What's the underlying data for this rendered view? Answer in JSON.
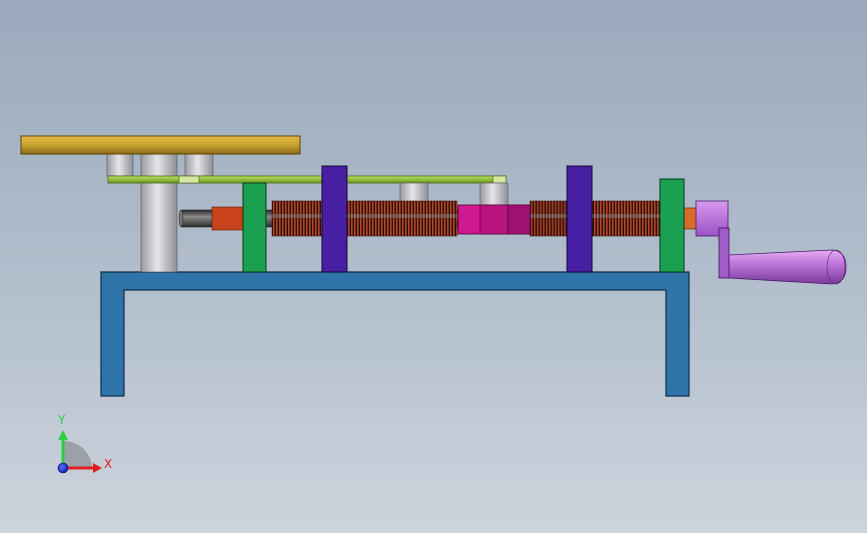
{
  "viewport": {
    "view": "front",
    "background_top": "#9aa9bc",
    "background_bottom": "#cdd4dd"
  },
  "triad": {
    "y_label": "Y",
    "x_label": "X",
    "y_color": "#2ecc40",
    "x_color": "#e02020",
    "z_color": "#1a2ee0"
  },
  "model_colors": {
    "base_frame": "#2e74a8",
    "top_plate": "#c9a22e",
    "rail": "#8fc23a",
    "support_green": "#1aa050",
    "support_purple": "#4620a0",
    "slider": "#d01890",
    "screw_thread": "#8a2b1a",
    "shaft": "#4a4a4a",
    "crank": "#b268d8",
    "column": "#c8c8cc"
  }
}
